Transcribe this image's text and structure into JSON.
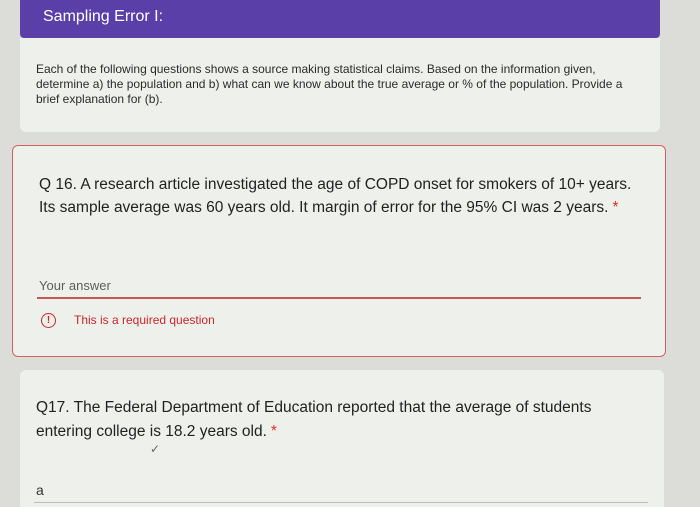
{
  "header": {
    "title": "Sampling Error I:"
  },
  "description": {
    "text": "Each of the following questions shows a source making statistical claims. Based on the information given, determine a) the population and b) what can we know about the true average or % of the population. Provide a brief explanation for (b)."
  },
  "questions": [
    {
      "text": "Q 16. A research article investigated the age of COPD onset for smokers of 10+ years. Its sample average was 60 years old. It margin of error for the 95% CI was 2 years.",
      "required_marker": "*",
      "answer_placeholder": "Your answer",
      "error_icon": "!",
      "error_text": "This is a required question"
    },
    {
      "text": "Q17. The Federal Department of Education reported that the average of students entering college is 18.2 years old.",
      "required_marker": "*",
      "answer_value": "a"
    }
  ],
  "colors": {
    "header": "#5a3fa8",
    "error": "#c62828",
    "card_background": "#eef0ec"
  },
  "icons": {
    "error": "alert-circle-icon"
  }
}
